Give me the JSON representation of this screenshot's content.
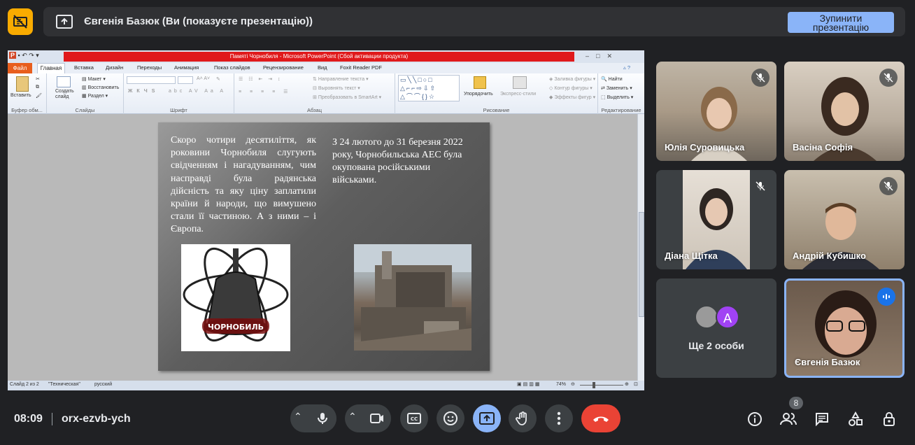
{
  "top_bar": {
    "presenter_title": "Євгенія Базюк (Ви (показуєте презентацію))",
    "stop_button_label": "Зупинити\nпрезентацію"
  },
  "powerpoint": {
    "window_title": "Памяті Чорнобиля - Microsoft PowerPoint (Сбой активации продукта)",
    "tabs": [
      "Файл",
      "Главная",
      "Вставка",
      "Дизайн",
      "Переходы",
      "Анимация",
      "Показ слайдов",
      "Рецензирование",
      "Вид",
      "Foxit Reader PDF"
    ],
    "groups": {
      "clipboard": "Буфер обм...",
      "slides": "Слайды",
      "font": "Шрифт",
      "paragraph": "Абзац",
      "drawing": "Рисование",
      "editing": "Редактирование"
    },
    "buttons": {
      "paste": "Вставить",
      "create_slide": "Создать\nслайд",
      "layout": "Макет",
      "restore": "Восстановить",
      "section": "Раздел",
      "text_direction": "Направление текста",
      "align_text": "Выровнять текст",
      "convert_smartart": "Преобразовать в SmartArt",
      "arrange": "Упорядочить",
      "quick_styles": "Экспресс-стили",
      "shape_fill": "Заливка фигуры",
      "shape_outline": "Контур фигуры",
      "shape_effects": "Эффекты фигур",
      "find": "Найти",
      "replace": "Заменить",
      "select": "Выделить"
    },
    "slide": {
      "text_left": "Скоро чотири десятиліття, як роковини Чорнобиля слугують свідченням і нагадуванням, чим насправді була радянська дійсність та яку ціну заплатили країни й народи, що вимушено стали її частиною. А з ними – і Європа.",
      "text_right": "З 24 лютого до 31 березня 2022 року, Чорнобильська АЕС була окупована російськими військами.",
      "logo_text": "ЧОРНОБИЛЬ"
    },
    "status": {
      "slide_info": "Слайд 2 из 2",
      "theme": "\"Техническая\"",
      "language": "русский",
      "zoom": "74%"
    }
  },
  "participants": [
    {
      "name": "Юлія Суровицька",
      "muted": true
    },
    {
      "name": "Васіна Софія",
      "muted": true
    },
    {
      "name": "Діана Щітка",
      "muted": true
    },
    {
      "name": "Андрій Кубишко",
      "muted": true
    },
    {
      "name": "Євгенія Базюк",
      "muted": false,
      "speaking": true
    }
  ],
  "others": {
    "label": "Ще 2 особи",
    "avatar_letter": "A"
  },
  "bottom_bar": {
    "time": "08:09",
    "meeting_code": "orx-ezvb-ych",
    "people_count": "8"
  },
  "colors": {
    "background": "#202124",
    "accent_blue": "#8ab4f8",
    "end_call": "#ea4335",
    "no_camera_badge": "#f9ab00",
    "avatar_purple": "#a142f4"
  }
}
